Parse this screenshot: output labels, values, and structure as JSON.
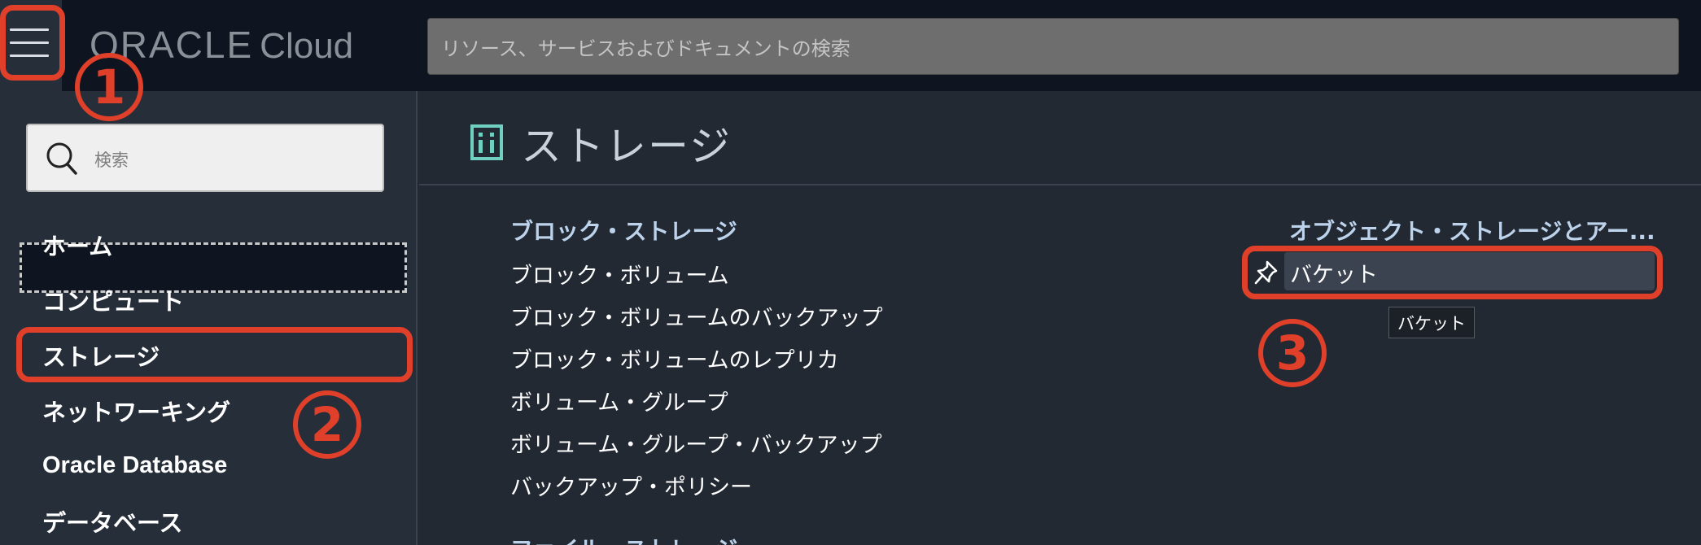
{
  "header": {
    "logo_text": "ORACLE",
    "logo_suffix": "Cloud",
    "search_placeholder": "リソース、サービスおよびドキュメントの検索"
  },
  "sidebar": {
    "search_placeholder": "検索",
    "items": [
      {
        "label": "ホーム"
      },
      {
        "label": "コンピュート"
      },
      {
        "label": "ストレージ"
      },
      {
        "label": "ネットワーキング"
      },
      {
        "label": "Oracle Database"
      },
      {
        "label": "データベース"
      }
    ],
    "selected": "ストレージ"
  },
  "main": {
    "title": "ストレージ",
    "block_storage": {
      "heading": "ブロック・ストレージ",
      "links": [
        "ブロック・ボリューム",
        "ブロック・ボリュームのバックアップ",
        "ブロック・ボリュームのレプリカ",
        "ボリューム・グループ",
        "ボリューム・グループ・バックアップ",
        "バックアップ・ポリシー"
      ]
    },
    "file_storage": {
      "heading": "ファイル・ストレージ"
    },
    "object_storage": {
      "heading": "オブジェクト・ストレージとアー...",
      "links": [
        "バケット"
      ]
    },
    "tooltip": "バケット"
  },
  "annotations": {
    "step1": "1",
    "step2": "2",
    "step3": "3",
    "color": "#e0402a"
  }
}
